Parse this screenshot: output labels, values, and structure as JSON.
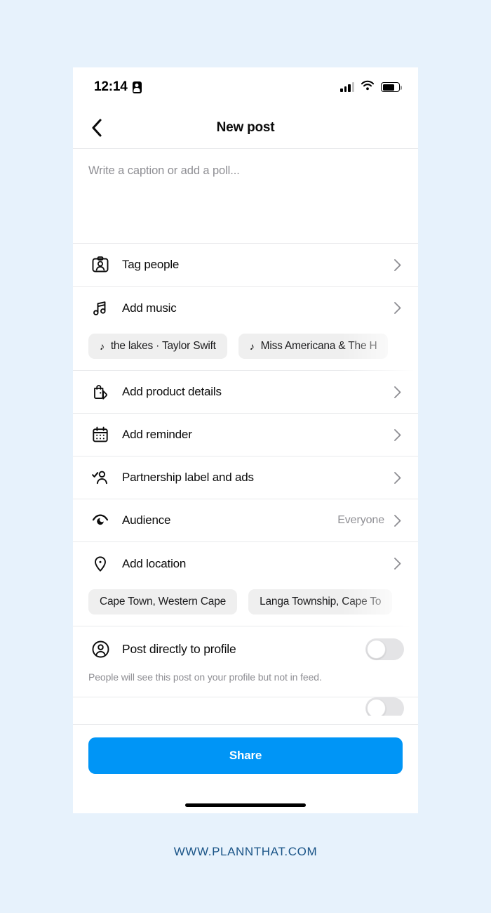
{
  "theme": {
    "page_background": "#e7f2fc",
    "phone_background": "#ffffff",
    "accent": "#0095f6",
    "chip_background": "#efefef",
    "muted_text": "#8e8e93",
    "footer_color": "#1a5487"
  },
  "status_bar": {
    "time": "12:14",
    "id_icon": "id-card-icon",
    "signal_icon": "cellular-signal-icon",
    "wifi_icon": "wifi-icon",
    "battery_icon": "battery-icon",
    "battery_level": 74
  },
  "nav": {
    "back_icon": "chevron-left-icon",
    "title": "New post"
  },
  "caption": {
    "placeholder": "Write a caption or add a poll...",
    "value": ""
  },
  "rows": [
    {
      "id": "tag-people",
      "icon": "tag-people-icon",
      "label": "Tag people",
      "value": "",
      "chevron": "chevron-right-icon"
    },
    {
      "id": "add-music",
      "icon": "music-note-icon",
      "label": "Add music",
      "value": "",
      "chevron": "chevron-right-icon"
    },
    {
      "id": "add-product",
      "icon": "shopping-bag-tag-icon",
      "label": "Add product details",
      "value": "",
      "chevron": "chevron-right-icon"
    },
    {
      "id": "add-reminder",
      "icon": "calendar-icon",
      "label": "Add reminder",
      "value": "",
      "chevron": "chevron-right-icon"
    },
    {
      "id": "partnership",
      "icon": "person-check-icon",
      "label": "Partnership label and ads",
      "value": "",
      "chevron": "chevron-right-icon"
    },
    {
      "id": "audience",
      "icon": "eye-icon",
      "label": "Audience",
      "value": "Everyone",
      "chevron": "chevron-right-icon"
    },
    {
      "id": "add-location",
      "icon": "location-pin-icon",
      "label": "Add location",
      "value": "",
      "chevron": "chevron-right-icon"
    }
  ],
  "music_chips": [
    {
      "icon": "music-note-icon",
      "label": "the lakes · Taylor Swift"
    },
    {
      "icon": "music-note-icon",
      "label": "Miss Americana & The H"
    }
  ],
  "location_chips": [
    {
      "label": "Cape Town, Western Cape"
    },
    {
      "label": "Langa Township, Cape To"
    }
  ],
  "post_to_profile": {
    "icon": "profile-circle-icon",
    "label": "Post directly to profile",
    "help_text": "People will see this post on your profile but not in feed.",
    "toggle_state": "off"
  },
  "bottom": {
    "share_label": "Share"
  },
  "footer": {
    "watermark": "WWW.PLANNTHAT.COM"
  }
}
